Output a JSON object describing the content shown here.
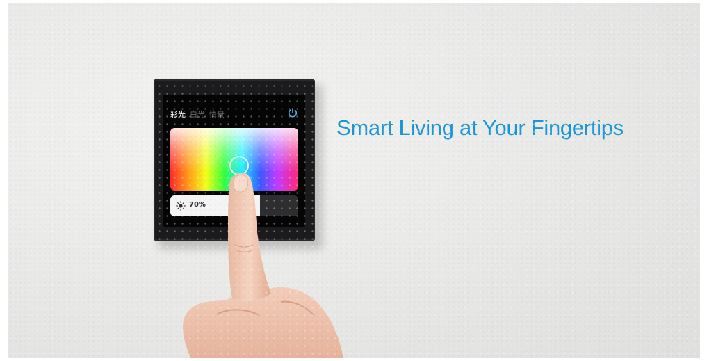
{
  "panel": {
    "tabs": [
      {
        "label": "彩光",
        "active": true
      },
      {
        "label": "白光",
        "active": false
      },
      {
        "label": "情景",
        "active": false
      }
    ],
    "power_icon": "power-icon",
    "brightness": {
      "label": "70%",
      "value": 0.7,
      "icon": "sun-icon"
    },
    "accent_color": "#4fb4e6"
  },
  "tagline": "Smart Living at Your Fingertips",
  "colors": {
    "tagline": "#1a95d6",
    "panel_bezel": "#1b1b1d",
    "wall": "#e8e8e7"
  }
}
